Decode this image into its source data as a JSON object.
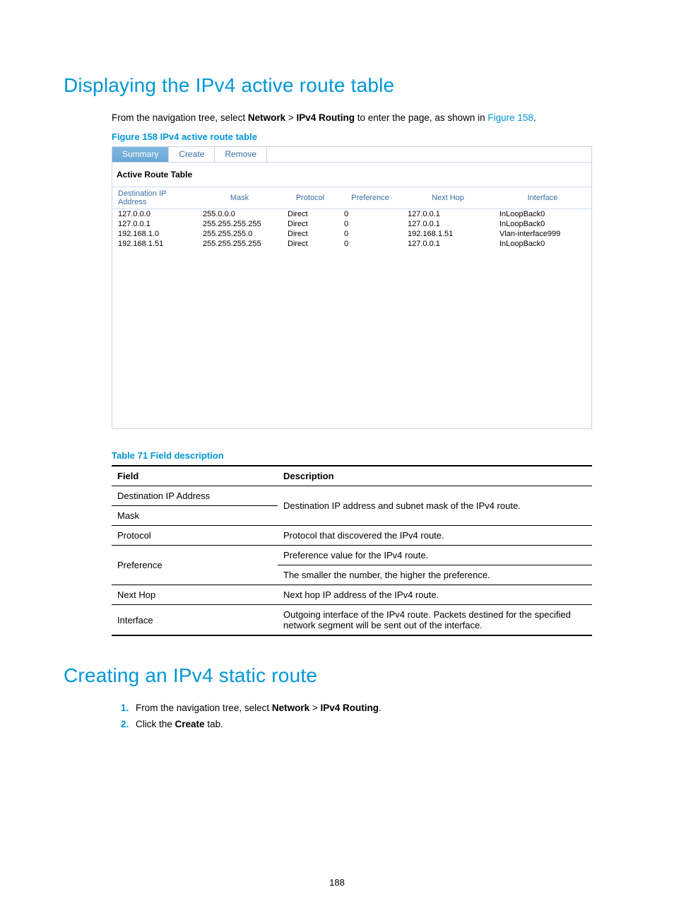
{
  "heading1": "Displaying the IPv4 active route table",
  "intro_prefix": "From the navigation tree, select ",
  "intro_nav1": "Network",
  "intro_sep": " > ",
  "intro_nav2": "IPv4 Routing",
  "intro_mid": " to enter the page, as shown in ",
  "intro_link": "Figure 158",
  "intro_suffix": ".",
  "figure_caption": "Figure 158 IPv4 active route table",
  "tabs": {
    "summary": "Summary",
    "create": "Create",
    "remove": "Remove"
  },
  "panel_title": "Active Route Table",
  "route_headers": {
    "dest": "Destination IP Address",
    "mask": "Mask",
    "proto": "Protocol",
    "pref": "Preference",
    "nexthop": "Next Hop",
    "iface": "Interface"
  },
  "routes": [
    {
      "dest": "127.0.0.0",
      "mask": "255.0.0.0",
      "proto": "Direct",
      "pref": "0",
      "nexthop": "127.0.0.1",
      "iface": "InLoopBack0"
    },
    {
      "dest": "127.0.0.1",
      "mask": "255.255.255.255",
      "proto": "Direct",
      "pref": "0",
      "nexthop": "127.0.0.1",
      "iface": "InLoopBack0"
    },
    {
      "dest": "192.168.1.0",
      "mask": "255.255.255.0",
      "proto": "Direct",
      "pref": "0",
      "nexthop": "192.168.1.51",
      "iface": "Vlan-interface999"
    },
    {
      "dest": "192.168.1.51",
      "mask": "255.255.255.255",
      "proto": "Direct",
      "pref": "0",
      "nexthop": "127.0.0.1",
      "iface": "InLoopBack0"
    }
  ],
  "table_caption": "Table 71 Field description",
  "desc_headers": {
    "field": "Field",
    "desc": "Description"
  },
  "desc_rows": {
    "dest": "Destination IP Address",
    "mask": "Mask",
    "dest_mask_desc": "Destination IP address and subnet mask of the IPv4 route.",
    "proto": "Protocol",
    "proto_desc": "Protocol that discovered the IPv4 route.",
    "pref": "Preference",
    "pref_desc1": "Preference value for the IPv4 route.",
    "pref_desc2": "The smaller the number, the higher the preference.",
    "nexthop": "Next Hop",
    "nexthop_desc": "Next hop IP address of the IPv4 route.",
    "iface": "Interface",
    "iface_desc": "Outgoing interface of the IPv4 route. Packets destined for the specified network segment will be sent out of the interface."
  },
  "heading2": "Creating an IPv4 static route",
  "step1_prefix": "From the navigation tree, select ",
  "step1_nav1": "Network",
  "step1_sep": " > ",
  "step1_nav2": "IPv4 Routing",
  "step1_suffix": ".",
  "step2_prefix": "Click the ",
  "step2_bold": "Create",
  "step2_suffix": " tab.",
  "page_number": "188",
  "chart_data": {
    "type": "table",
    "title": "Active Route Table",
    "columns": [
      "Destination IP Address",
      "Mask",
      "Protocol",
      "Preference",
      "Next Hop",
      "Interface"
    ],
    "rows": [
      [
        "127.0.0.0",
        "255.0.0.0",
        "Direct",
        0,
        "127.0.0.1",
        "InLoopBack0"
      ],
      [
        "127.0.0.1",
        "255.255.255.255",
        "Direct",
        0,
        "127.0.0.1",
        "InLoopBack0"
      ],
      [
        "192.168.1.0",
        "255.255.255.0",
        "Direct",
        0,
        "192.168.1.51",
        "Vlan-interface999"
      ],
      [
        "192.168.1.51",
        "255.255.255.255",
        "Direct",
        0,
        "127.0.0.1",
        "InLoopBack0"
      ]
    ]
  }
}
